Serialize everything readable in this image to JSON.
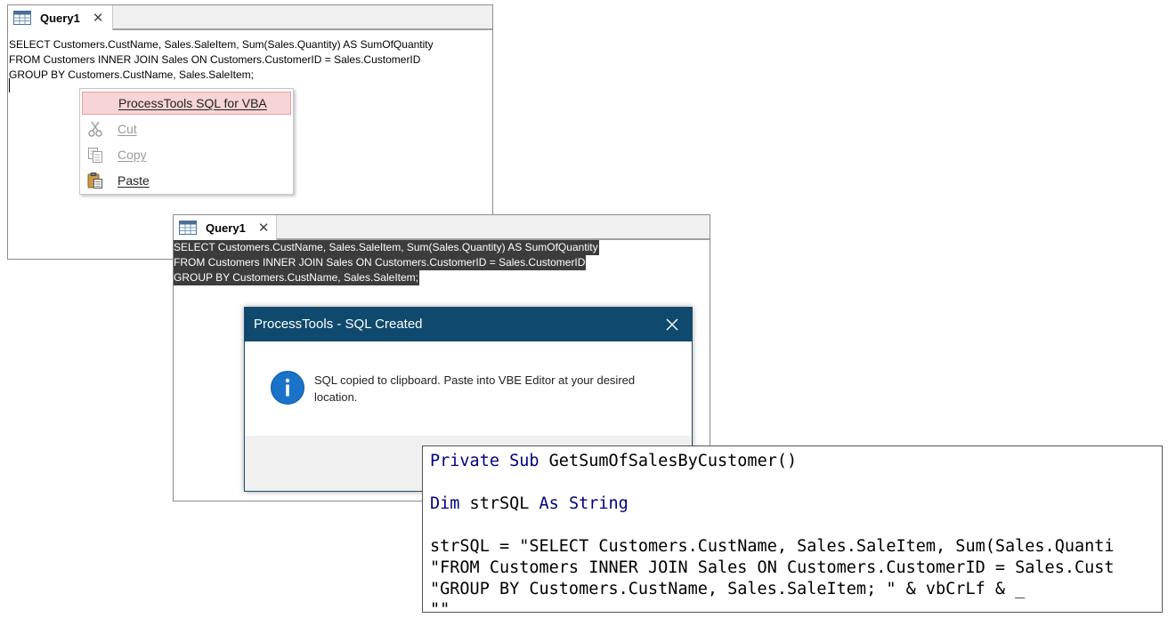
{
  "query_window_1": {
    "tab": {
      "label": "Query1",
      "close_glyph": "✕"
    },
    "sql_lines": [
      "SELECT Customers.CustName, Sales.SaleItem, Sum(Sales.Quantity) AS SumOfQuantity",
      "FROM Customers INNER JOIN Sales ON Customers.CustomerID = Sales.CustomerID",
      "GROUP BY Customers.CustName, Sales.SaleItem;"
    ]
  },
  "context_menu": {
    "items": [
      {
        "label": "ProcessTools SQL for VBA",
        "icon": "none",
        "state": "highlighted"
      },
      {
        "label": "Cut",
        "icon": "scissors-icon",
        "state": "disabled"
      },
      {
        "label": "Copy",
        "icon": "copy-icon",
        "state": "disabled"
      },
      {
        "label": "Paste",
        "icon": "clipboard-paste-icon",
        "state": "enabled"
      }
    ],
    "highlight_color": "#f7d4d5"
  },
  "query_window_2": {
    "tab": {
      "label": "Query1",
      "close_glyph": "✕"
    },
    "sql_lines": [
      "SELECT Customers.CustName, Sales.SaleItem, Sum(Sales.Quantity) AS SumOfQuantity",
      "FROM Customers INNER JOIN Sales ON Customers.CustomerID = Sales.CustomerID",
      "GROUP BY Customers.CustName, Sales.SaleItem;"
    ],
    "selected": true
  },
  "dialog": {
    "title": "ProcessTools - SQL Created",
    "close_glyph": "✕",
    "message": "SQL copied to clipboard. Paste into VBE Editor at your desired location.",
    "icon": "info-icon",
    "title_bar_color": "#0f4a6e",
    "icon_color": "#1a73c8"
  },
  "code_panel": {
    "lines": [
      {
        "kw1": "Private Sub",
        "rest": " GetSumOfSalesByCustomer()"
      },
      {
        "kw1": "",
        "rest": ""
      },
      {
        "kw1": "Dim",
        "rest": " strSQL ",
        "kw2": "As String"
      },
      {
        "kw1": "",
        "rest": ""
      },
      {
        "kw1": "",
        "rest": "strSQL = \"SELECT Customers.CustName, Sales.SaleItem, Sum(Sales.Quanti"
      },
      {
        "kw1": "",
        "rest": "\"FROM Customers INNER JOIN Sales ON Customers.CustomerID = Sales.Cust"
      },
      {
        "kw1": "",
        "rest": "\"GROUP BY Customers.CustName, Sales.SaleItem; \" & vbCrLf & _"
      },
      {
        "kw1": "",
        "rest": "\"\""
      }
    ],
    "keyword_color": "#00007f"
  }
}
